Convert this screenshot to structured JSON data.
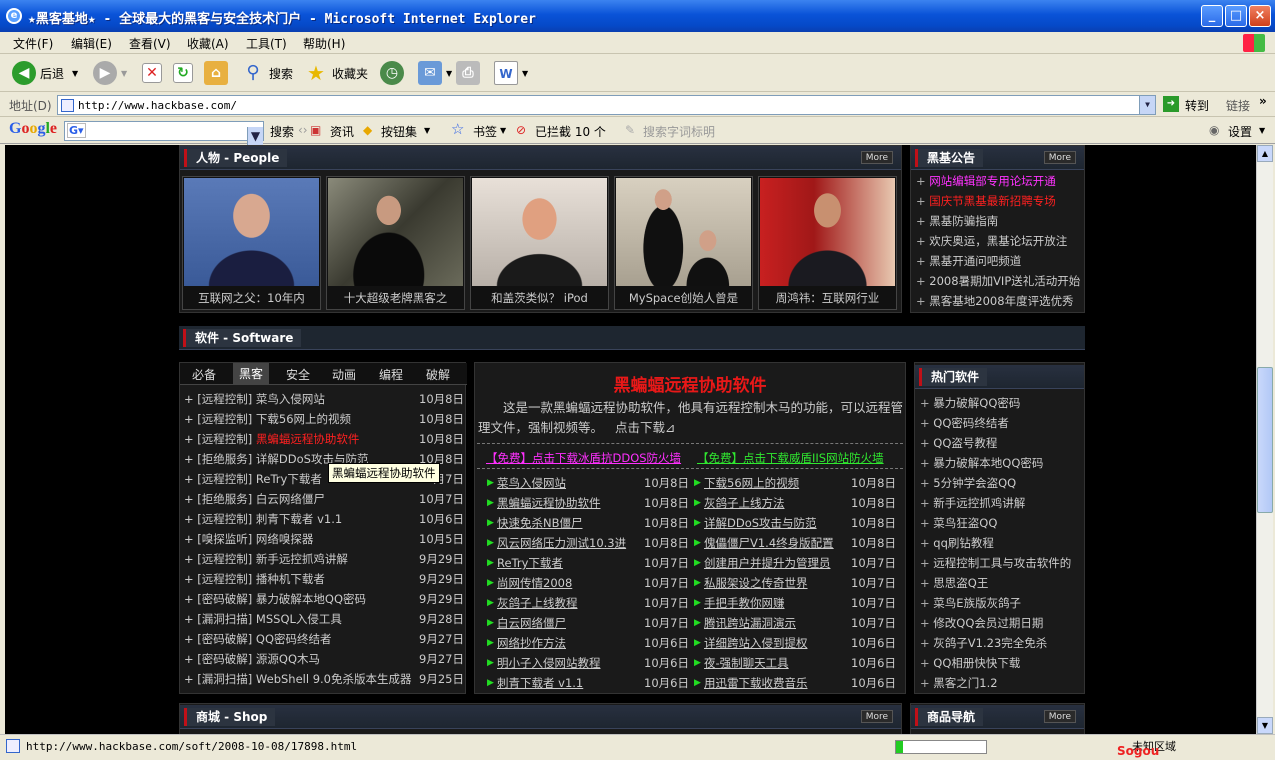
{
  "window": {
    "title": "★黑客基地★ - 全球最大的黑客与安全技术门户 - Microsoft Internet Explorer"
  },
  "menu": [
    "文件(F)",
    "编辑(E)",
    "查看(V)",
    "收藏(A)",
    "工具(T)",
    "帮助(H)"
  ],
  "toolbar": {
    "back": "后退",
    "search": "搜索",
    "favorites": "收藏夹"
  },
  "address": {
    "label": "地址(D)",
    "url": "http://www.hackbase.com/",
    "go": "转到",
    "links": "链接"
  },
  "google": {
    "search": "搜索",
    "news": "资讯",
    "buttons": "按钮集",
    "bookmarks": "书签",
    "blocked": "已拦截 10 个",
    "highlight": "搜索字词标明",
    "settings": "设置"
  },
  "people": {
    "heading": "人物 - People",
    "more": "More",
    "photos": [
      {
        "caption": "互联网之父：10年内"
      },
      {
        "caption": "十大超级老牌黑客之"
      },
      {
        "caption": "和盖茨类似？ iPod"
      },
      {
        "caption": "MySpace创始人曾是"
      },
      {
        "caption": "周鸿祎：互联网行业"
      }
    ]
  },
  "notice": {
    "heading": "黑基公告",
    "more": "More",
    "items": [
      {
        "text": "网站编辑部专用论坛开通",
        "color": "#ff33ff"
      },
      {
        "text": "国庆节黑基最新招聘专场",
        "color": "#ff2020"
      },
      {
        "text": "黑基防骗指南",
        "color": "#cccccc"
      },
      {
        "text": "欢庆奥运，黑基论坛开放注",
        "color": "#cccccc"
      },
      {
        "text": "黑基开通问吧频道",
        "color": "#cccccc"
      },
      {
        "text": "2008暑期加VIP送礼活动开始",
        "color": "#cccccc"
      },
      {
        "text": "黑客基地2008年度评选优秀",
        "color": "#cccccc"
      }
    ]
  },
  "software": {
    "heading": "软件 - Software",
    "tabs": [
      "必备",
      "黑客",
      "安全",
      "动画",
      "编程",
      "破解"
    ],
    "active_tab": "黑客",
    "list": [
      {
        "name": "[远程控制] 菜鸟入侵网站",
        "date": "10月8日"
      },
      {
        "name": "[远程控制] 下载56网上的视频",
        "date": "10月8日"
      },
      {
        "name": "[远程控制] ",
        "hl": "黑蝙蝠远程协助软件",
        "date": "10月8日"
      },
      {
        "name": "[拒绝服务] 详解DDoS攻击与防范",
        "date": "10月8日"
      },
      {
        "name": "[远程控制] ReTry下载者",
        "date": "10月7日"
      },
      {
        "name": "[拒绝服务] 白云网络僵尸",
        "date": "10月7日"
      },
      {
        "name": "[远程控制] 刺青下载者 v1.1",
        "date": "10月6日"
      },
      {
        "name": "[嗅探监听] 网络嗅探器",
        "date": "10月5日"
      },
      {
        "name": "[远程控制] 新手远控抓鸡讲解",
        "date": "9月29日"
      },
      {
        "name": "[远程控制] 播种机下载者",
        "date": "9月29日"
      },
      {
        "name": "[密码破解] 暴力破解本地QQ密码",
        "date": "9月29日"
      },
      {
        "name": "[漏洞扫描] MSSQL入侵工具",
        "date": "9月28日"
      },
      {
        "name": "[密码破解] QQ密码终结者",
        "date": "9月27日"
      },
      {
        "name": "[密码破解] 源源QQ木马",
        "date": "9月27日"
      },
      {
        "name": "[漏洞扫描] WebShell 9.0免杀版本生成器",
        "date": "9月25日"
      }
    ],
    "tooltip": "黑蝙蝠远程协助软件"
  },
  "featured": {
    "title": "黑蝙蝠远程协助软件",
    "body": "这是一款黑蝙蝠远程协助软件，他具有远程控制木马的功能，可以远程管理文件，强制视频等。",
    "link": "点击下载⊿",
    "promo1": "【免费】点击下载冰盾抗DDOS防火墙",
    "promo2": "【免费】点击下载威盾IIS网站防火墙",
    "left": [
      {
        "name": "菜鸟入侵网站",
        "date": "10月8日"
      },
      {
        "name": "黑蝙蝠远程协助软件",
        "date": "10月8日"
      },
      {
        "name": "快速免杀NB僵尸",
        "date": "10月8日"
      },
      {
        "name": "风云网络压力测试10.3进",
        "date": "10月8日"
      },
      {
        "name": "ReTry下载者",
        "date": "10月7日"
      },
      {
        "name": "尚网传情2008",
        "date": "10月7日"
      },
      {
        "name": "灰鸽子上线教程",
        "date": "10月7日"
      },
      {
        "name": "白云网络僵尸",
        "date": "10月7日"
      },
      {
        "name": "网络抄作方法",
        "date": "10月6日"
      },
      {
        "name": "明小子入侵网站教程",
        "date": "10月6日"
      },
      {
        "name": "刺青下载者 v1.1",
        "date": "10月6日"
      }
    ],
    "right": [
      {
        "name": "下载56网上的视频",
        "date": "10月8日"
      },
      {
        "name": "灰鸽子上线方法",
        "date": "10月8日"
      },
      {
        "name": "详解DDoS攻击与防范",
        "date": "10月8日"
      },
      {
        "name": "傀儡僵尸V1.4终身版配置",
        "date": "10月8日"
      },
      {
        "name": "创建用户并提升为管理员",
        "date": "10月7日"
      },
      {
        "name": "私服架设之传奇世界",
        "date": "10月7日"
      },
      {
        "name": "手把手教你网赚",
        "date": "10月7日"
      },
      {
        "name": "腾讯跨站漏洞演示",
        "date": "10月7日"
      },
      {
        "name": "详细跨站入侵到提权",
        "date": "10月6日"
      },
      {
        "name": "夜-强制聊天工具",
        "date": "10月6日"
      },
      {
        "name": "用迅雷下载收费音乐",
        "date": "10月6日"
      }
    ]
  },
  "hot": {
    "heading": "热门软件",
    "items": [
      "暴力破解QQ密码",
      "QQ密码终结者",
      "QQ盗号教程",
      "暴力破解本地QQ密码",
      "5分钟学会盗QQ",
      "新手远控抓鸡讲解",
      "菜鸟狂盗QQ",
      "qq刷钻教程",
      "远程控制工具与攻击软件的",
      "思思盗Q王",
      "菜鸟E族版灰鸽子",
      "修改QQ会员过期日期",
      "灰鸽子V1.23完全免杀",
      "QQ相册快快下载",
      "黑客之门1.2"
    ]
  },
  "shop": {
    "heading": "商城 - Shop",
    "more": "More"
  },
  "goods": {
    "heading": "商品导航",
    "more": "More"
  },
  "status": {
    "url": "http://www.hackbase.com/soft/2008-10-08/17898.html",
    "zone": "未知区域",
    "sogou": "Sogou"
  }
}
